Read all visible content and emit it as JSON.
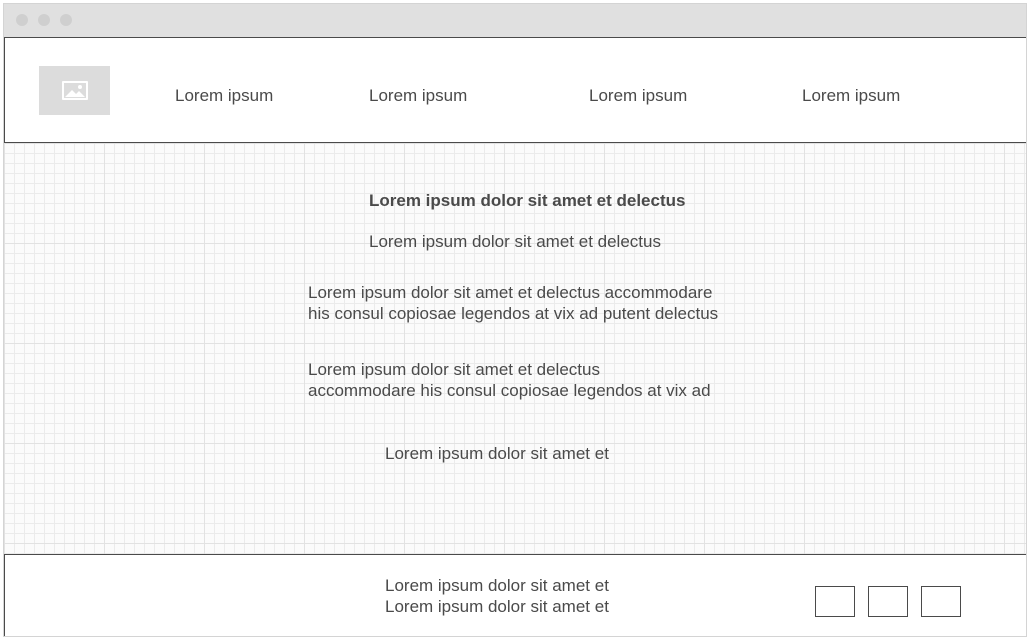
{
  "window": {
    "controls": [
      "close",
      "minimize",
      "maximize"
    ]
  },
  "header": {
    "logo_icon": "image-icon",
    "nav": [
      {
        "label": "Lorem ipsum"
      },
      {
        "label": "Lorem ipsum"
      },
      {
        "label": "Lorem ipsum"
      },
      {
        "label": "Lorem ipsum"
      }
    ]
  },
  "main": {
    "heading": "Lorem ipsum dolor sit amet et delectus",
    "subheading": "Lorem ipsum dolor sit amet et delectus",
    "paragraph1": {
      "line1": "Lorem ipsum dolor sit amet et delectus accommodare",
      "line2": "his consul copiosae legendos at vix ad putent delectus"
    },
    "paragraph2": {
      "line1": "Lorem ipsum dolor sit amet et delectus",
      "line2": "accommodare his consul copiosae legendos at vix ad"
    },
    "single_line": "Lorem ipsum dolor sit amet et"
  },
  "footer": {
    "line1": "Lorem ipsum dolor sit amet et",
    "line2": "Lorem ipsum dolor sit amet et",
    "social_buttons": [
      "social-button-1",
      "social-button-2",
      "social-button-3"
    ]
  },
  "colors": {
    "titlebar": "#e0e0e0",
    "text": "#4a4a4a",
    "placeholder": "#dcdcdc",
    "grid": "#ebebeb"
  }
}
